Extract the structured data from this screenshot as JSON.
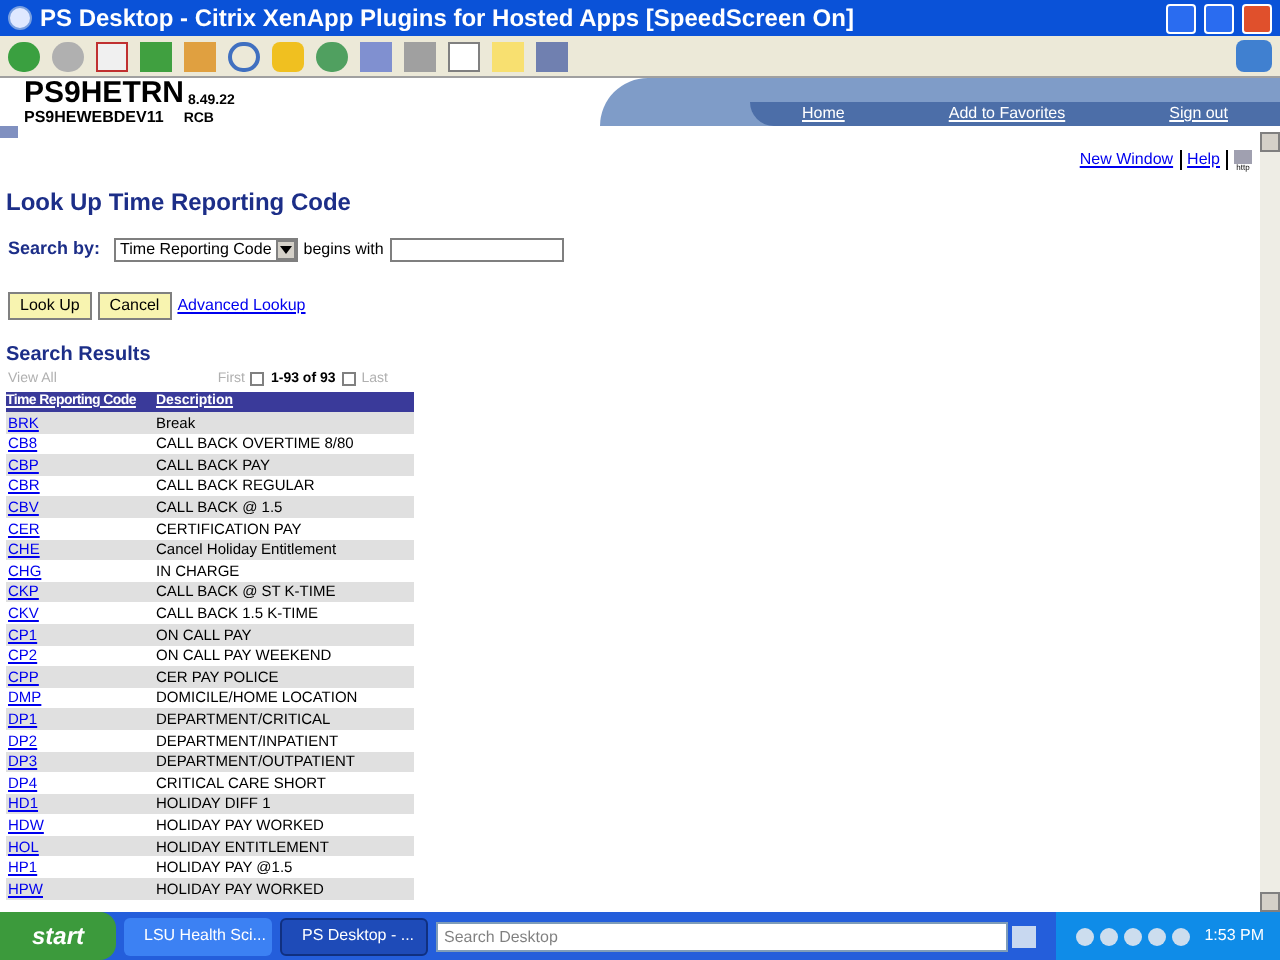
{
  "window": {
    "title": "PS Desktop - Citrix XenApp Plugins for Hosted Apps [SpeedScreen On]"
  },
  "header": {
    "app": "PS9HETRN",
    "version": "8.49.22",
    "server": "PS9HEWEBDEV11",
    "user": "RCB",
    "links": [
      "Home",
      "Add to Favorites",
      "Sign out"
    ]
  },
  "top_links": [
    "New Window",
    "Help"
  ],
  "help_icon_label": "http",
  "page_title": "Look Up Time Reporting Code",
  "search": {
    "label": "Search by:",
    "field": "Time Reporting Code",
    "operator": "begins with"
  },
  "buttons": [
    "Look Up",
    "Cancel"
  ],
  "advanced_link": "Advanced Lookup",
  "results": {
    "title": "Search Results",
    "view_all": "View All",
    "first": "First",
    "range": "1-93 of 93",
    "last": "Last",
    "columns": [
      "Time Reporting Code",
      "Description"
    ],
    "rows": [
      {
        "code": "BRK",
        "description": "Break"
      },
      {
        "code": "CB8",
        "description": "CALL BACK OVERTIME 8/80"
      },
      {
        "code": "CBP",
        "description": "CALL BACK PAY"
      },
      {
        "code": "CBR",
        "description": "CALL BACK REGULAR"
      },
      {
        "code": "CBV",
        "description": "CALL BACK @ 1.5"
      },
      {
        "code": "CER",
        "description": "CERTIFICATION PAY"
      },
      {
        "code": "CHE",
        "description": "Cancel Holiday Entitlement"
      },
      {
        "code": "CHG",
        "description": "IN CHARGE"
      },
      {
        "code": "CKP",
        "description": "CALL BACK @ ST K-TIME"
      },
      {
        "code": "CKV",
        "description": "CALL BACK 1.5 K-TIME"
      },
      {
        "code": "CP1",
        "description": "ON CALL PAY"
      },
      {
        "code": "CP2",
        "description": "ON CALL PAY WEEKEND"
      },
      {
        "code": "CPP",
        "description": "CER PAY POLICE"
      },
      {
        "code": "DMP",
        "description": "DOMICILE/HOME LOCATION"
      },
      {
        "code": "DP1",
        "description": "DEPARTMENT/CRITICAL"
      },
      {
        "code": "DP2",
        "description": "DEPARTMENT/INPATIENT"
      },
      {
        "code": "DP3",
        "description": "DEPARTMENT/OUTPATIENT"
      },
      {
        "code": "DP4",
        "description": "CRITICAL CARE SHORT"
      },
      {
        "code": "HD1",
        "description": "HOLIDAY DIFF 1"
      },
      {
        "code": "HDW",
        "description": "HOLIDAY PAY WORKED"
      },
      {
        "code": "HOL",
        "description": "HOLIDAY ENTITLEMENT"
      },
      {
        "code": "HP1",
        "description": "HOLIDAY PAY @1.5"
      },
      {
        "code": "HPW",
        "description": "HOLIDAY PAY WORKED"
      }
    ]
  },
  "taskbar": {
    "start": "start",
    "tasks": [
      {
        "label": "LSU Health Sci...",
        "selected": false
      },
      {
        "label": "PS Desktop - ...",
        "selected": true
      }
    ],
    "search_placeholder": "Search Desktop",
    "clock": "1:53 PM"
  }
}
